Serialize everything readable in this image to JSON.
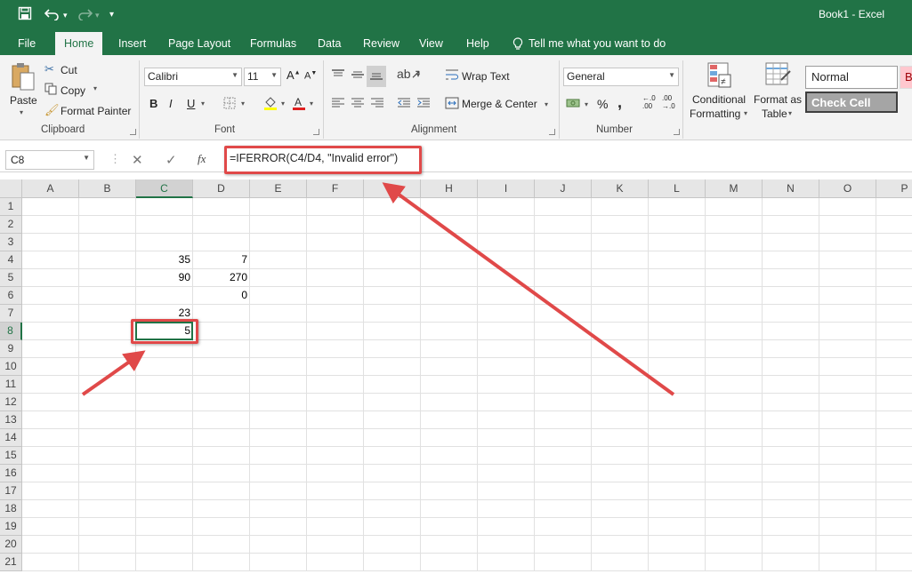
{
  "titlebar": {
    "title": "Book1  -  Excel",
    "save_icon": "save-icon",
    "undo_icon": "undo-icon",
    "redo_icon": "redo-icon",
    "customize_icon": "customize-qat-icon"
  },
  "tabs": [
    "File",
    "Home",
    "Insert",
    "Page Layout",
    "Formulas",
    "Data",
    "Review",
    "View",
    "Help"
  ],
  "tell_me": "Tell me what you want to do",
  "ribbon": {
    "clipboard": {
      "label": "Clipboard",
      "paste": "Paste",
      "cut": "Cut",
      "copy": "Copy",
      "format_painter": "Format Painter"
    },
    "font": {
      "label": "Font",
      "name": "Calibri",
      "size": "11",
      "bold": "B",
      "italic": "I",
      "underline": "U"
    },
    "alignment": {
      "label": "Alignment",
      "wrap_text": "Wrap Text",
      "merge_center": "Merge & Center"
    },
    "number": {
      "label": "Number",
      "format": "General",
      "percent": "%",
      "comma": ","
    },
    "styles": {
      "conditional_line1": "Conditional",
      "conditional_line2": "Formatting",
      "format_as_line1": "Format as",
      "format_as_line2": "Table",
      "normal": "Normal",
      "check_cell": "Check Cell",
      "bad": "B"
    }
  },
  "formula_bar": {
    "name_box": "C8",
    "fx": "fx",
    "formula": "=IFERROR(C4/D4, \"Invalid error\")"
  },
  "grid": {
    "columns": [
      "A",
      "B",
      "C",
      "D",
      "E",
      "F",
      "G",
      "H",
      "I",
      "J",
      "K",
      "L",
      "M",
      "N",
      "O",
      "P"
    ],
    "rows": [
      "1",
      "2",
      "3",
      "4",
      "5",
      "6",
      "7",
      "8",
      "9",
      "10",
      "11",
      "12",
      "13",
      "14",
      "15",
      "16",
      "17",
      "18",
      "19",
      "20",
      "21"
    ],
    "selected_cell": "C8",
    "cells": [
      {
        "ref": "C4",
        "value": "35"
      },
      {
        "ref": "D4",
        "value": "7"
      },
      {
        "ref": "C5",
        "value": "90"
      },
      {
        "ref": "D5",
        "value": "270"
      },
      {
        "ref": "D6",
        "value": "0"
      },
      {
        "ref": "C7",
        "value": "23"
      },
      {
        "ref": "C8",
        "value": "5"
      }
    ]
  },
  "annotations": {
    "color": "#e04949"
  },
  "colors": {
    "accent": "#217346",
    "ribbon_bg": "#f3f3f3",
    "header_bg": "#e6e6e6"
  }
}
